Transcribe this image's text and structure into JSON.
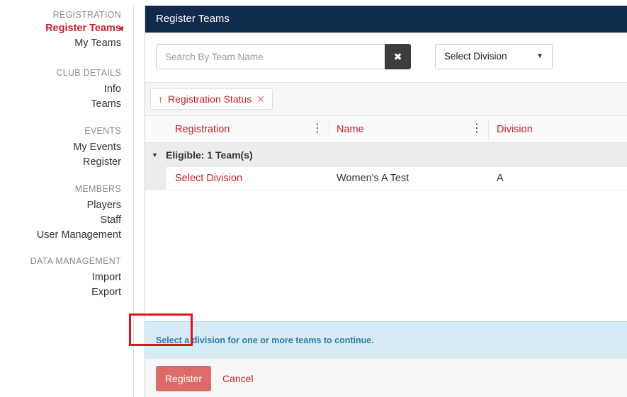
{
  "sidebar": {
    "registration": {
      "title": "REGISTRATION",
      "items": [
        {
          "label": "Register Teams",
          "active": true
        },
        {
          "label": "My Teams"
        }
      ]
    },
    "club_details": {
      "title": "CLUB DETAILS",
      "items": [
        {
          "label": "Info"
        },
        {
          "label": "Teams"
        }
      ]
    },
    "events": {
      "title": "EVENTS",
      "items": [
        {
          "label": "My Events"
        },
        {
          "label": "Register"
        }
      ]
    },
    "members": {
      "title": "MEMBERS",
      "items": [
        {
          "label": "Players"
        },
        {
          "label": "Staff"
        },
        {
          "label": "User Management"
        }
      ]
    },
    "data_management": {
      "title": "DATA MANAGEMENT",
      "items": [
        {
          "label": "Import"
        },
        {
          "label": "Export"
        }
      ]
    }
  },
  "panel": {
    "title": "Register Teams",
    "search": {
      "placeholder": "Search By Team Name",
      "value": ""
    },
    "division_select": {
      "selected": "Select Division"
    },
    "group_chip": {
      "label": "Registration Status"
    },
    "columns": [
      "Registration",
      "Name",
      "Division"
    ],
    "group": {
      "label": "Eligible: 1 Team(s)"
    },
    "rows": [
      {
        "registration": "Select Division",
        "name": "Women's A Test",
        "division": "A"
      }
    ],
    "info_message": "Select a division for one or more teams to continue.",
    "footer": {
      "register_label": "Register",
      "cancel_label": "Cancel"
    }
  },
  "colors": {
    "header_bg": "#0f2a4a",
    "accent": "#c8202c",
    "info_bg": "#d6ebf6",
    "info_text": "#2f7ba7",
    "register_btn": "#d9534f"
  }
}
